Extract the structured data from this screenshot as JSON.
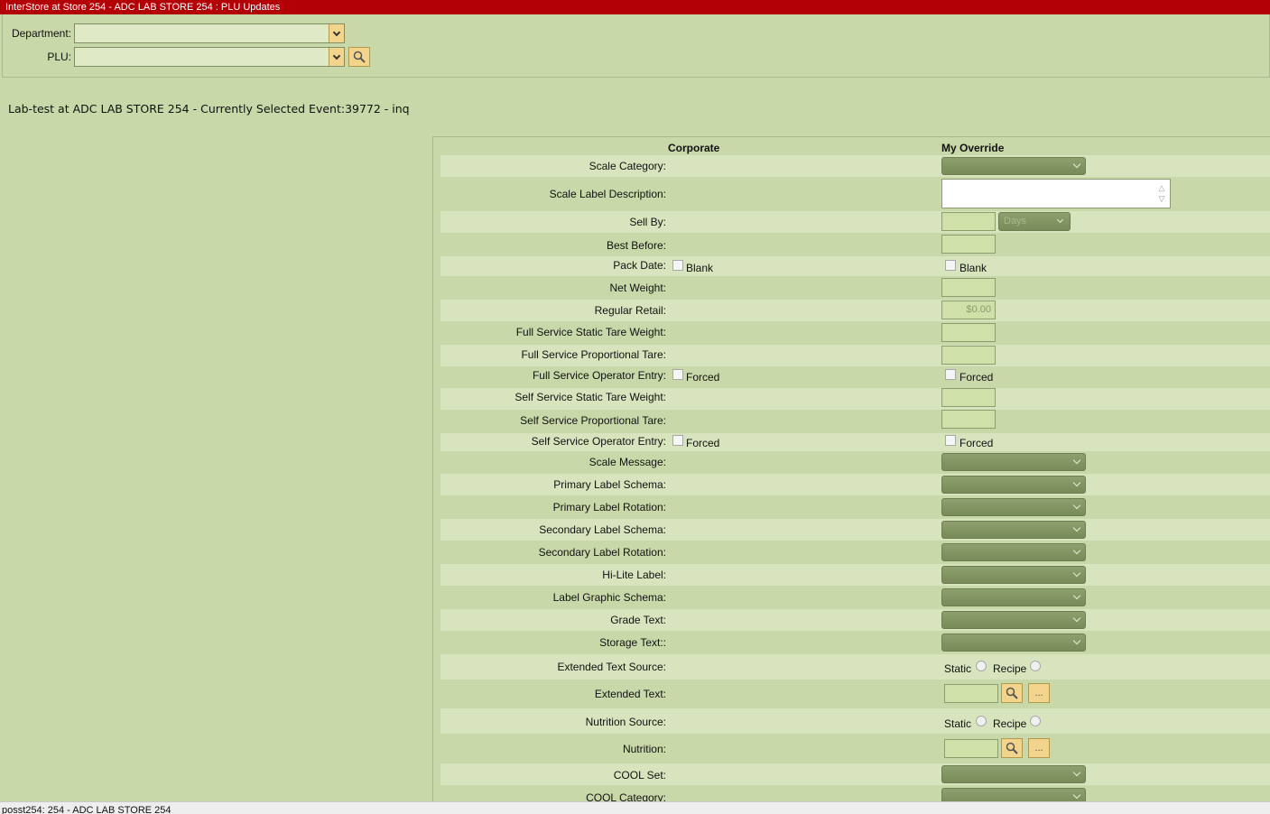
{
  "window": {
    "title": "InterStore at Store 254 - ADC LAB STORE 254 : PLU Updates"
  },
  "filters": {
    "department_label": "Department:",
    "department_value": "",
    "plu_label": "PLU:",
    "plu_value": ""
  },
  "event_info": "Lab-test at ADC LAB STORE 254 - Currently Selected Event:39772 - inq",
  "columns": {
    "corporate": "Corporate",
    "override": "My Override"
  },
  "fields": {
    "scale_category": "Scale Category:",
    "scale_label_description": "Scale Label Description:",
    "sell_by": "Sell By:",
    "sell_by_unit": "Days",
    "best_before": "Best Before:",
    "pack_date": "Pack Date:",
    "blank": "Blank",
    "net_weight": "Net Weight:",
    "regular_retail": "Regular Retail:",
    "regular_retail_value": "$0.00",
    "fs_static_tare": "Full Service Static Tare Weight:",
    "fs_prop_tare": "Full Service Proportional Tare:",
    "fs_operator_entry": "Full Service Operator Entry:",
    "forced": "Forced",
    "ss_static_tare": "Self Service Static Tare Weight:",
    "ss_prop_tare": "Self Service Proportional Tare:",
    "ss_operator_entry": "Self Service Operator Entry:",
    "scale_message": "Scale Message:",
    "primary_label_schema": "Primary Label Schema:",
    "primary_label_rotation": "Primary Label Rotation:",
    "secondary_label_schema": "Secondary Label Schema:",
    "secondary_label_rotation": "Secondary Label Rotation:",
    "hilite_label": "Hi-Lite Label:",
    "label_graphic_schema": "Label Graphic Schema:",
    "grade_text": "Grade Text:",
    "storage_text": "Storage Text::",
    "extended_text_source": "Extended Text Source:",
    "static": "Static",
    "recipe": "Recipe",
    "extended_text": "Extended Text:",
    "nutrition_source": "Nutrition Source:",
    "nutrition": "Nutrition:",
    "cool_set": "COOL Set:",
    "cool_category": "COOL Category:",
    "ellipsis": "..."
  },
  "status_bar": "posst254: 254 - ADC LAB STORE 254",
  "icons": [
    "chevron-down-icon",
    "search-icon",
    "spin-arrows-icon"
  ]
}
